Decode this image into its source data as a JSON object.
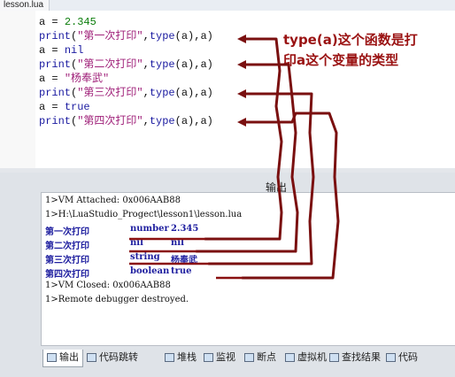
{
  "window": {
    "file_tab": "lesson.lua"
  },
  "editor": {
    "lines": [
      [
        {
          "t": "a = ",
          "c": "var"
        },
        {
          "t": "2.345",
          "c": "num"
        }
      ],
      [
        {
          "t": "print",
          "c": "kw"
        },
        {
          "t": "(",
          "c": "op"
        },
        {
          "t": "\"第一次打印\"",
          "c": "str"
        },
        {
          "t": ",",
          "c": "op"
        },
        {
          "t": "type",
          "c": "kw"
        },
        {
          "t": "(a),a)",
          "c": "op"
        }
      ],
      [
        {
          "t": "a = ",
          "c": "var"
        },
        {
          "t": "nil",
          "c": "kw"
        }
      ],
      [
        {
          "t": "print",
          "c": "kw"
        },
        {
          "t": "(",
          "c": "op"
        },
        {
          "t": "\"第二次打印\"",
          "c": "str"
        },
        {
          "t": ",",
          "c": "op"
        },
        {
          "t": "type",
          "c": "kw"
        },
        {
          "t": "(a),a)",
          "c": "op"
        }
      ],
      [
        {
          "t": "a = ",
          "c": "var"
        },
        {
          "t": "\"杨奉武\"",
          "c": "str"
        }
      ],
      [
        {
          "t": "print",
          "c": "kw"
        },
        {
          "t": "(",
          "c": "op"
        },
        {
          "t": "\"第三次打印\"",
          "c": "str"
        },
        {
          "t": ",",
          "c": "op"
        },
        {
          "t": "type",
          "c": "kw"
        },
        {
          "t": "(a),a)",
          "c": "op"
        }
      ],
      [
        {
          "t": "a = ",
          "c": "var"
        },
        {
          "t": "true",
          "c": "kw"
        }
      ],
      [
        {
          "t": "print",
          "c": "kw"
        },
        {
          "t": "(",
          "c": "op"
        },
        {
          "t": "\"第四次打印\"",
          "c": "str"
        },
        {
          "t": ",",
          "c": "op"
        },
        {
          "t": "type",
          "c": "kw"
        },
        {
          "t": "(a),a)",
          "c": "op"
        }
      ]
    ]
  },
  "annotation": {
    "line1": "type(a)这个函数是打",
    "line2": "印a这个变量的类型"
  },
  "output_panel": {
    "title": "输出",
    "lines": [
      {
        "kind": "log",
        "text": "1>VM Attached: 0x006AAB88"
      },
      {
        "kind": "log",
        "text": "1>H:\\LuaStudio_Progect\\lesson1\\lesson.lua"
      },
      {
        "kind": "result",
        "cols": [
          "第一次打印",
          "number",
          "2.345"
        ]
      },
      {
        "kind": "result",
        "cols": [
          "第二次打印",
          "nil",
          "nil"
        ]
      },
      {
        "kind": "result",
        "cols": [
          "第三次打印",
          "string",
          "杨奉武"
        ]
      },
      {
        "kind": "result",
        "cols": [
          "第四次打印",
          "boolean",
          "true"
        ]
      },
      {
        "kind": "log",
        "text": "1>VM Closed: 0x006AAB88"
      },
      {
        "kind": "log",
        "text": "1>Remote debugger destroyed."
      }
    ]
  },
  "bottom_tabs": [
    {
      "label": "输出",
      "icon": "output-icon",
      "active": true
    },
    {
      "label": "代码跳转",
      "icon": "code-jump-icon",
      "active": false
    },
    {
      "label": "堆栈",
      "icon": "stack-icon",
      "active": false
    },
    {
      "label": "监视",
      "icon": "watch-icon",
      "active": false
    },
    {
      "label": "断点",
      "icon": "breakpoint-icon",
      "active": false
    },
    {
      "label": "虚拟机",
      "icon": "vm-icon",
      "active": false
    },
    {
      "label": "查找结果",
      "icon": "find-results-icon",
      "active": false
    },
    {
      "label": "代码",
      "icon": "code-icon",
      "active": false
    }
  ],
  "colors": {
    "annotation": "#9a1212",
    "arrow": "#7a1010",
    "output_result": "#2020a0",
    "output_underline": "#8a1010"
  }
}
